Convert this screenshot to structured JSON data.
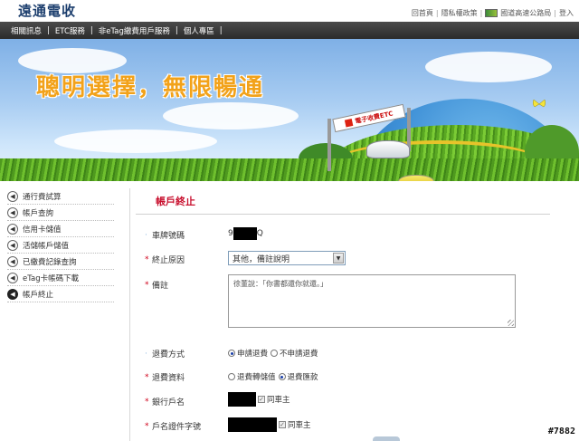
{
  "header": {
    "logo_text": "遠通電收",
    "links": [
      "回首頁",
      "隱私權政策",
      "國道高速公路局",
      "登入"
    ]
  },
  "nav": {
    "items": [
      "相關訊息",
      "ETC服務",
      "非eTag繳費用戶服務",
      "個人專區"
    ]
  },
  "banner": {
    "slogan": "聰明選擇，無限暢通",
    "sign_text": "電子收費ETC"
  },
  "sidebar": {
    "items": [
      {
        "label": "通行費試算"
      },
      {
        "label": "帳戶查詢"
      },
      {
        "label": "信用卡儲值"
      },
      {
        "label": "活儲帳戶儲值"
      },
      {
        "label": "已繳費記錄查詢"
      },
      {
        "label": "eTag卡帳碼下載"
      },
      {
        "label": "帳戶終止"
      }
    ]
  },
  "form": {
    "title": "帳戶終止",
    "plate_label": "車牌號碼",
    "plate_prefix": "9",
    "plate_suffix": "Q",
    "reason_label": "終止原因",
    "reason_value": "其他，備註說明",
    "remark_label": "備註",
    "remark_value": "徐董說：「你書都還你就還。」",
    "refund_method_label": "退費方式",
    "refund_method_options": [
      "申請退費",
      "不申請退費"
    ],
    "refund_info_label": "退費資料",
    "refund_info_options": [
      "退費轉儲值",
      "退費匯款"
    ],
    "account_name_label": "銀行戶名",
    "same_owner_label": "同車主",
    "id_label": "戶名證件字號",
    "same_owner_label2": "同車主"
  },
  "watermark": "#7882",
  "colors": {
    "accent_red": "#c8102e",
    "nav_bg": "#3a3a3a",
    "slogan": "#f2a21a"
  }
}
